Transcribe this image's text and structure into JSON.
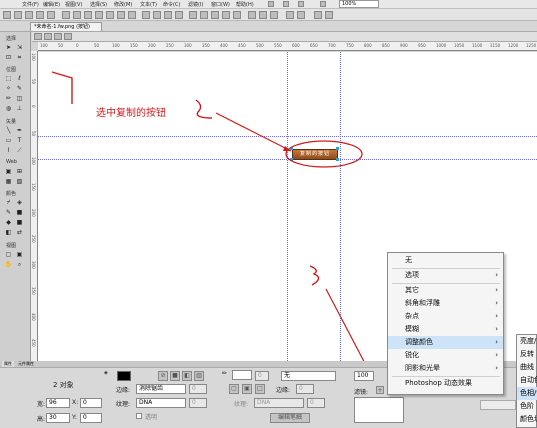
{
  "menubar": {
    "items": [
      "文件(F)",
      "编辑(E)",
      "视图(V)",
      "选择(S)",
      "修改(M)",
      "文本(T)",
      "命令(C)",
      "滤镜(I)",
      "窗口(W)",
      "帮助(H)"
    ],
    "zoom": "100%"
  },
  "document": {
    "tab_label": "*未命名-1.fw.png (按钮)",
    "ruler_ticks": [
      "100",
      "50",
      "0",
      "50",
      "100",
      "150",
      "200",
      "250",
      "300",
      "350",
      "400",
      "450",
      "500",
      "550",
      "600",
      "650",
      "700",
      "750",
      "800",
      "850",
      "900",
      "950",
      "1000",
      "1050",
      "1100",
      "1150",
      "1200",
      "1250"
    ]
  },
  "tools": {
    "sections": [
      "选择",
      "位图",
      "矢量",
      "Web",
      "颜色",
      "视图"
    ]
  },
  "canvas": {
    "button_text": "复制的按钮"
  },
  "annotations": {
    "label_text": "选中复制的按钮",
    "colors": {
      "annotation": "#d01a1a",
      "guide": "#6a6aff"
    }
  },
  "properties": {
    "tabs": [
      "属性",
      "元件属性"
    ],
    "object_count": "2 对象",
    "edge_label": "边缘:",
    "edge_value": "消除锯齿",
    "edge_num": "0",
    "texture_label": "纹理:",
    "texture_value": "DNA",
    "texture_num": "0",
    "transparent_label": "透明",
    "stroke_label": "0",
    "stroke_value": "无",
    "edge2_label": "边缘:",
    "edge2_num": "0",
    "texture2_label": "纹理:",
    "texture2_value": "DNA",
    "texture2_num": "0",
    "edit_stroke": "编辑笔触",
    "width_label": "宽:",
    "width_value": "96",
    "height_label": "高:",
    "height_value": "30",
    "x_label": "X:",
    "x_value": "0",
    "y_label": "Y:",
    "y_value": "0",
    "opacity_value": "100",
    "filters_label": "滤镜:"
  },
  "filter_menu": {
    "items": [
      {
        "label": "无",
        "submenu": false
      },
      {
        "label": "选项",
        "submenu": true
      },
      {
        "label": "其它",
        "submenu": true
      },
      {
        "label": "斜角和浮雕",
        "submenu": true
      },
      {
        "label": "杂点",
        "submenu": true
      },
      {
        "label": "模糊",
        "submenu": true
      },
      {
        "label": "调整颜色",
        "submenu": true,
        "selected": true
      },
      {
        "label": "锐化",
        "submenu": true
      },
      {
        "label": "阴影和光晕",
        "submenu": true
      },
      {
        "label": "Photoshop 动态效果",
        "submenu": false
      }
    ]
  },
  "submenu": {
    "items": [
      "亮度/对比度",
      "反转",
      "曲线",
      "自动色阶",
      "色相/饱和度",
      "色阶",
      "颜色填充"
    ],
    "selected_index": 4
  }
}
